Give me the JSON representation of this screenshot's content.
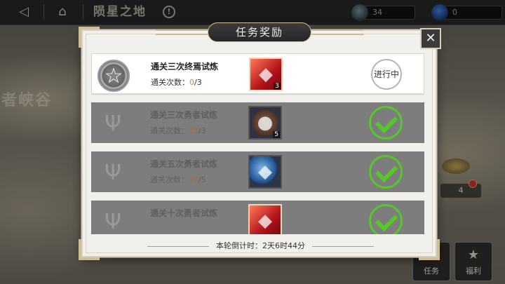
{
  "topbar": {
    "back_icon": "back-arrow-icon",
    "home_icon": "home-icon",
    "title": "陨星之地",
    "info_icon": "info-icon",
    "info_glyph": "!",
    "resources": [
      {
        "icon": "gear-resource-icon",
        "value": "34"
      },
      {
        "icon": "blue-gem-icon",
        "value": "0"
      }
    ]
  },
  "background": {
    "map_label": "者峡谷",
    "node_count": "4"
  },
  "corner_buttons": {
    "task_label": "任务",
    "welfare_label": "福利"
  },
  "dialog": {
    "title": "任务奖励",
    "close_glyph": "✕",
    "tasks": [
      {
        "name": "通关三次终焉试炼",
        "progress_label": "通关次数：",
        "current": "0",
        "total": "/3",
        "reward_icon": "red-crystal-icon",
        "reward_count": "3",
        "status": "进行中",
        "state": "active"
      },
      {
        "name": "通关三次勇者试炼",
        "progress_label": "通关次数：",
        "current": "13",
        "total": "/3",
        "reward_icon": "orb-gem-icon",
        "reward_count": "5",
        "status": "",
        "state": "done"
      },
      {
        "name": "通关五次勇者试炼",
        "progress_label": "通关次数：",
        "current": "13",
        "total": "/5",
        "reward_icon": "blue-crystal-icon",
        "reward_count": "",
        "status": "",
        "state": "done"
      },
      {
        "name": "通关十次勇者试炼",
        "progress_label": "",
        "current": "",
        "total": "",
        "reward_icon": "red-crystal-icon",
        "reward_count": "",
        "status": "",
        "state": "done"
      }
    ],
    "countdown": "本轮倒计时：2天6时44分"
  },
  "colors": {
    "progress_highlight": "#e0863a",
    "check_green": "#57c62a",
    "dialog_bg": "#f1f0ec",
    "completed_row": "#7d7d7d"
  }
}
